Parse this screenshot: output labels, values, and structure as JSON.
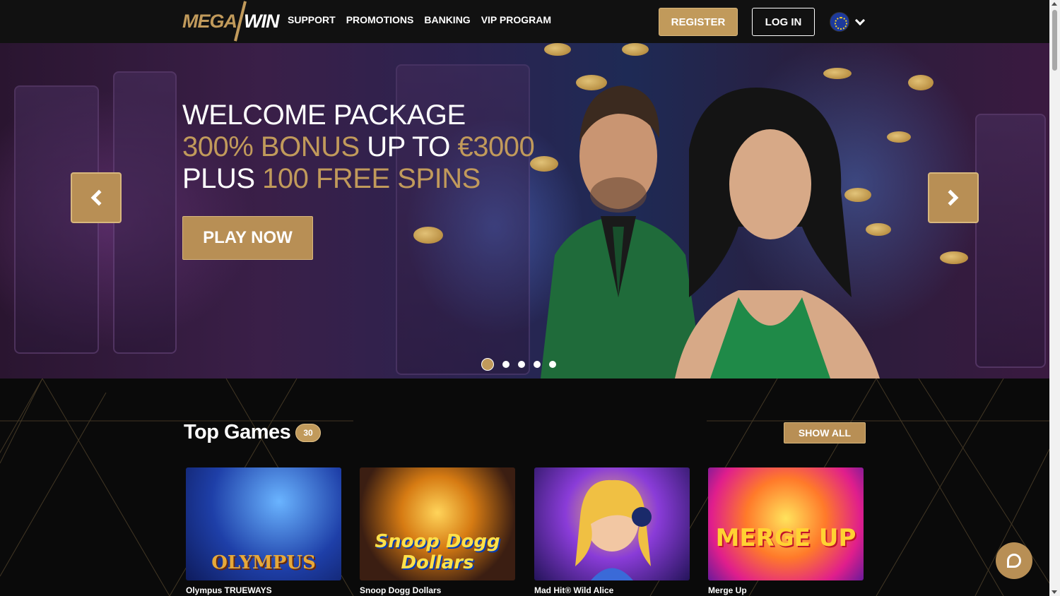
{
  "header": {
    "logo": {
      "part1": "MEGA",
      "part2": "WIN"
    },
    "nav": [
      "SUPPORT",
      "PROMOTIONS",
      "BANKING",
      "VIP PROGRAM"
    ],
    "register_label": "REGISTER",
    "login_label": "LOG IN",
    "language_icon": "eu-flag-icon"
  },
  "hero": {
    "line1": "WELCOME PACKAGE",
    "line2_gold": "300% BONUS",
    "line2_white": " UP TO ",
    "line2_gold2": "€3000",
    "line3_white": "PLUS ",
    "line3_gold": "100 FREE SPINS",
    "cta_label": "PLAY NOW",
    "slides_total": 5,
    "active_slide": 1
  },
  "top_games": {
    "title": "Top Games",
    "count": "30",
    "show_all_label": "SHOW ALL",
    "games": [
      {
        "name": "Olympus TRUEWAYS",
        "art": "OLYMPUS"
      },
      {
        "name": "Snoop Dogg Dollars",
        "art": "Snoop Dogg Dollars"
      },
      {
        "name": "Mad Hit® Wild Alice",
        "art": ""
      },
      {
        "name": "Merge Up",
        "art": "MERGE UP"
      }
    ]
  },
  "colors": {
    "accent": "#c19a5b",
    "header_bg": "#111111",
    "page_bg": "#0a0a0a"
  }
}
